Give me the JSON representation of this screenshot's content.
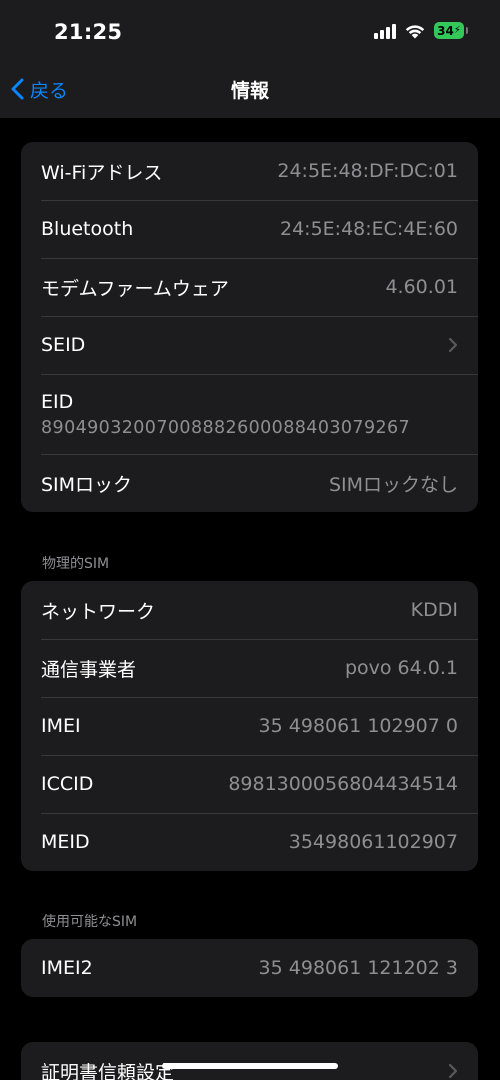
{
  "status_bar": {
    "time": "21:25",
    "battery": "34",
    "icons": [
      "cellular-signal-icon",
      "wifi-icon",
      "battery-charging-icon"
    ],
    "battery_color": "#34c759"
  },
  "nav": {
    "back_label": "戻る",
    "title": "情報",
    "accent_color": "#0a84ff"
  },
  "group1": [
    {
      "label": "Wi-Fiアドレス",
      "value": "24:5E:48:DF:DC:01"
    },
    {
      "label": "Bluetooth",
      "value": "24:5E:48:EC:4E:60"
    },
    {
      "label": "モデムファームウェア",
      "value": "4.60.01"
    },
    {
      "label": "SEID",
      "value": ""
    },
    {
      "label": "EID",
      "value": "89049032007008882600088403079267"
    },
    {
      "label": "SIMロック",
      "value": "SIMロックなし"
    }
  ],
  "section_physical_sim": "物理的SIM",
  "group2": [
    {
      "label": "ネットワーク",
      "value": "KDDI"
    },
    {
      "label": "通信事業者",
      "value": "povo 64.0.1"
    },
    {
      "label": "IMEI",
      "value": "35 498061 102907 0"
    },
    {
      "label": "ICCID",
      "value": "8981300056804434514"
    },
    {
      "label": "MEID",
      "value": "35498061102907"
    }
  ],
  "section_available_sim": "使用可能なSIM",
  "group3": [
    {
      "label": "IMEI2",
      "value": "35 498061 121202 3"
    }
  ],
  "group4": [
    {
      "label": "証明書信頼設定"
    }
  ]
}
